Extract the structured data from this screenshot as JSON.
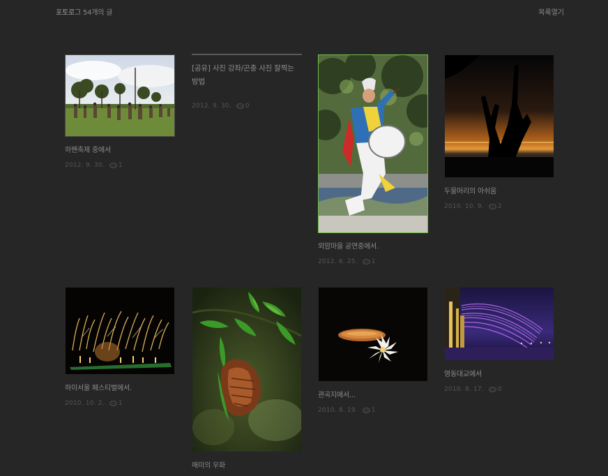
{
  "header": {
    "blog_name": "포토로그",
    "post_count": "54개의 글",
    "list_toggle": "목록열기"
  },
  "posts": [
    {
      "title": "하짼축제 중에서",
      "date": "2012. 9. 30.",
      "comments": "1",
      "thumb": "festival-dancers-trees"
    },
    {
      "title": "[공유] 사진 강좌/곤충 사진 잘찍는 방법",
      "date": "2012. 9. 30.",
      "comments": "0"
    },
    {
      "title": "외암마을 공연중에서.",
      "date": "2012. 6. 25.",
      "comments": "1",
      "thumb": "drum-dancer"
    },
    {
      "title": "두물머리의 아쉬움",
      "date": "2010. 10. 9.",
      "comments": "2",
      "thumb": "sunset-tree-silhouette"
    },
    {
      "title": "하이서울 페스티벌에서.",
      "date": "2010. 10. 2.",
      "comments": "1",
      "thumb": "fireworks"
    },
    {
      "title": "매미의 우화",
      "date": "",
      "comments": "",
      "thumb": "cicada-shell-leaves"
    },
    {
      "title": "관곡지에서...",
      "date": "2010. 8. 19.",
      "comments": "1",
      "thumb": "white-lotus-night"
    },
    {
      "title": "영동대교에서",
      "date": "2010. 8. 17.",
      "comments": "0",
      "thumb": "bridge-fountain-purple"
    }
  ],
  "colors": {
    "background": "#262626",
    "active_border": "#6fbf4a",
    "text": "#8c8c8c",
    "meta": "#555555"
  }
}
